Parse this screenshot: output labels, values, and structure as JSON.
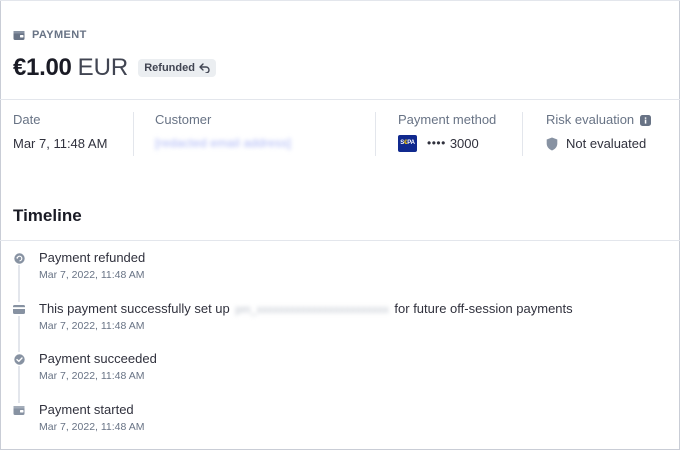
{
  "header": {
    "section_label": "PAYMENT",
    "section_icon": "wallet-icon",
    "amount": "€1.00",
    "currency": "EUR",
    "status_badge": "Refunded",
    "status_icon": "refund-arrow-icon"
  },
  "summary": {
    "date": {
      "label": "Date",
      "value": "Mar 7, 11:48 AM"
    },
    "customer": {
      "label": "Customer",
      "value": "[redacted email address]"
    },
    "payment_method": {
      "label": "Payment method",
      "brand": "SEPA",
      "dots": "••••",
      "last4": "3000"
    },
    "risk": {
      "label": "Risk evaluation",
      "value": "Not evaluated",
      "info_icon": "info-icon",
      "status_icon": "shield-icon"
    }
  },
  "timeline": {
    "title": "Timeline",
    "events": [
      {
        "text": "Payment refunded",
        "time": "Mar 7, 2022, 11:48 AM",
        "icon": "refund-icon"
      },
      {
        "text_before": "This payment successfully set up",
        "redacted": "pm_xxxxxxxxxxxxxxxxxxxxxxxx",
        "text_after": "for future off-session payments",
        "time": "Mar 7, 2022, 11:48 AM",
        "icon": "card-icon"
      },
      {
        "text": "Payment succeeded",
        "time": "Mar 7, 2022, 11:48 AM",
        "icon": "check-circle-icon"
      },
      {
        "text": "Payment started",
        "time": "Mar 7, 2022, 11:48 AM",
        "icon": "wallet-icon"
      }
    ]
  },
  "colors": {
    "text_primary": "#30313d",
    "text_secondary": "#687385",
    "badge_bg": "#ebeef1",
    "sepa_blue": "#10298e",
    "divider": "#e3e6ec"
  }
}
